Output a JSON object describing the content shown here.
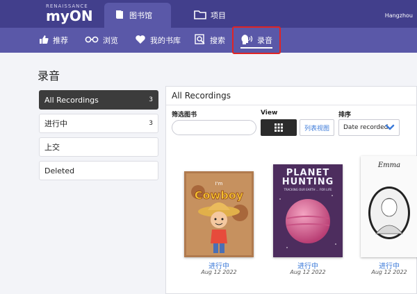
{
  "header": {
    "brand_small": "RENAISSANCE",
    "brand_big": "myON",
    "tabs": [
      {
        "label": "图书馆",
        "icon": "book-icon"
      },
      {
        "label": "项目",
        "icon": "folder-icon"
      }
    ],
    "user": "Hangzhou"
  },
  "subnav": {
    "items": [
      {
        "label": "推荐",
        "icon": "thumbs-up-icon"
      },
      {
        "label": "浏览",
        "icon": "glasses-icon"
      },
      {
        "label": "我的书库",
        "icon": "heart-icon"
      },
      {
        "label": "搜索",
        "icon": "search-icon"
      },
      {
        "label": "录音",
        "icon": "voice-icon"
      }
    ]
  },
  "page_title": "录音",
  "sidebar": {
    "items": [
      {
        "label": "All Recordings",
        "count": "3"
      },
      {
        "label": "进行中",
        "count": "3"
      },
      {
        "label": "上交",
        "count": ""
      },
      {
        "label": "Deleted",
        "count": ""
      }
    ]
  },
  "panel": {
    "title": "All Recordings",
    "filter_label": "筛选图书",
    "filter_placeholder": "",
    "view_label": "View",
    "list_view_label": "列表视图",
    "sort_label": "排序",
    "sort_value": "Date recorded"
  },
  "books": [
    {
      "status": "进行中",
      "date": "Aug 12 2022",
      "cover_line1": "I'm",
      "cover_line2": "Cowboy"
    },
    {
      "status": "进行中",
      "date": "Aug 12 2022",
      "cover_title": "PLANET HUNTING",
      "cover_subtitle": "TRACKING OUR EARTH ... FOR LIFE"
    },
    {
      "status": "进行中",
      "date": "Aug 12 2022",
      "cover_title": "Emma"
    }
  ],
  "colors": {
    "header_bg": "#423f8c",
    "subnav_bg": "#5a58a8",
    "highlight_box": "#e02424",
    "status_link": "#3d7bd9"
  }
}
